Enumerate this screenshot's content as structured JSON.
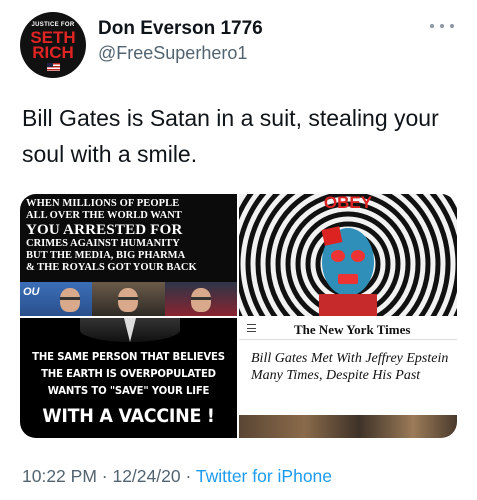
{
  "tweet": {
    "display_name": "Don Everson 1776",
    "handle": "@FreeSuperhero1",
    "text": "Bill Gates is Satan in a suit, stealing your soul with a smile.",
    "time": "10:22 PM",
    "date": "12/24/20",
    "separator": " · ",
    "source": "Twitter for iPhone"
  },
  "avatar": {
    "top_text": "JUSTICE FOR",
    "line1": "SETH",
    "line2": "RICH"
  },
  "icons": {
    "more": "more-horizontal-icon",
    "menu": "hamburger-menu-icon",
    "flag": "us-flag-icon"
  },
  "media": {
    "top_left": {
      "lines": [
        "WHEN MILLIONS OF PEOPLE",
        "ALL OVER THE WORLD WANT",
        "YOU ARRESTED FOR",
        "CRIMES AGAINST HUMANITY",
        "BUT THE MEDIA, BIG PHARMA",
        "& THE ROYALS GOT YOUR BACK"
      ],
      "brand": "OU"
    },
    "top_right": {
      "title": "OBEY"
    },
    "bottom_left": {
      "lines": [
        "THE SAME PERSON THAT BELIEVES",
        "THE EARTH IS OVERPOPULATED",
        "WANTS TO \"SAVE\" YOUR LIFE",
        "WITH A VACCINE !"
      ]
    },
    "bottom_right": {
      "publication": "The New York Times",
      "headline": "Bill Gates Met With Jeffrey Epstein Many Times, Despite His Past"
    }
  },
  "colors": {
    "accent": "#1d9bf0",
    "secondary_text": "#536471",
    "avatar_red": "#e02424"
  }
}
